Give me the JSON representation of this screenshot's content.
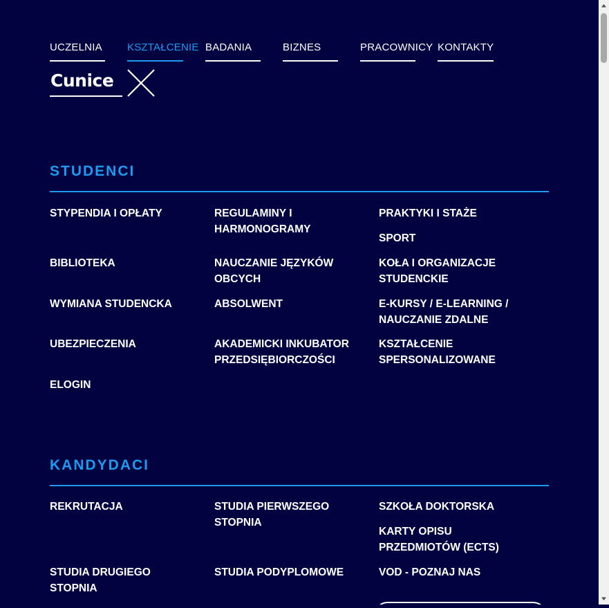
{
  "nav": {
    "items": [
      {
        "label": "UCZELNIA",
        "active": false
      },
      {
        "label": "KSZTAŁCENIE",
        "active": true
      },
      {
        "label": "BADANIA",
        "active": false
      },
      {
        "label": "BIZNES",
        "active": false
      },
      {
        "label": "PRACOWNICY",
        "active": false
      },
      {
        "label": "KONTAKTY",
        "active": false
      }
    ]
  },
  "logo": {
    "text": "Cunice"
  },
  "colors": {
    "background": "#020240",
    "accent": "#1d9bf0",
    "text": "#ffffff"
  },
  "sections": [
    {
      "title": "STUDENCI",
      "links": [
        "STYPENDIA I OPŁATY",
        "REGULAMINY I HARMONOGRAMY",
        "PRAKTYKI I STAŻE",
        "SPORT",
        "BIBLIOTEKA",
        "NAUCZANIE JĘZYKÓW OBCYCH",
        "KOŁA I ORGANIZACJE STUDENCKIE",
        "WYMIANA STUDENCKA",
        "ABSOLWENT",
        "E-KURSY / E-LEARNING / NAUCZANIE ZDALNE",
        "UBEZPIECZENIA",
        "AKADEMICKI INKUBATOR PRZEDSIĘBIORCZOŚCI",
        "KSZTAŁCENIE SPERSONALIZOWANE",
        "ELOGIN"
      ]
    },
    {
      "title": "KANDYDACI",
      "links": [
        "REKRUTACJA",
        "STUDIA PIERWSZEGO STOPNIA",
        "SZKOŁA DOKTORSKA",
        "KARTY OPISU PRZEDMIOTÓW (ECTS)",
        "STUDIA DRUGIEGO STOPNIA",
        "STUDIA PODYPLOMOWE",
        "VOD - POZNAJ NAS"
      ]
    }
  ]
}
